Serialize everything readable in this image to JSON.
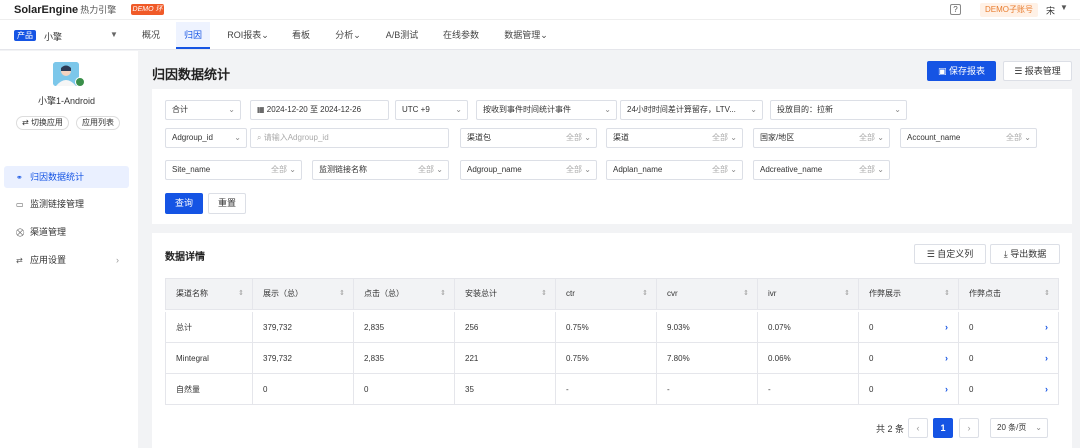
{
  "brand": {
    "logo": "SolarEngine",
    "subtitle": "热力引擎",
    "demo_tag": "DEMO 环境"
  },
  "header": {
    "help_icon": "?",
    "demo_account": "DEMO子账号",
    "user": "宋",
    "user_caret": "▼"
  },
  "nav": {
    "product_tag": "产品",
    "app_name": "小擎",
    "app_caret": "▼",
    "items": [
      "概况",
      "归因",
      "ROI报表⌄",
      "看板",
      "分析⌄",
      "A/B测试",
      "在线参数",
      "数据管理⌄"
    ],
    "active_index": 1
  },
  "sidebar": {
    "device": "小擎1-Android",
    "switch_app": "切换应用",
    "app_list": "应用列表",
    "items": [
      {
        "label": "归因数据统计",
        "icon": "attribution-icon",
        "glyph": "⚭"
      },
      {
        "label": "监测链接管理",
        "icon": "monitor-link-icon",
        "glyph": "▭"
      },
      {
        "label": "渠道管理",
        "icon": "channel-icon",
        "glyph": "⛒"
      },
      {
        "label": "应用设置",
        "icon": "settings-icon",
        "glyph": "⇄",
        "chevron": "›"
      }
    ],
    "active_index": 0
  },
  "page": {
    "title": "归因数据统计",
    "save_report": "保存报表",
    "manage_report": "报表管理"
  },
  "filters": {
    "row1": {
      "agg": "合计",
      "date_range": "2024-12-20 至 2024-12-26",
      "timezone": "UTC +9",
      "stat_method": "按收到事件时间统计事件",
      "retention": "24小时时间差计算留存，LTV...",
      "goal": "投放目的：拉新"
    },
    "adgroup_id_label": "Adgroup_id",
    "adgroup_id_placeholder": "请输入Adgroup_id",
    "dropdowns": [
      {
        "label": "渠道包",
        "value": "全部"
      },
      {
        "label": "渠道",
        "value": "全部"
      },
      {
        "label": "国家/地区",
        "value": "全部"
      },
      {
        "label": "Account_name",
        "value": "全部"
      },
      {
        "label": "Site_name",
        "value": "全部"
      },
      {
        "label": "监测链接名称",
        "value": "全部"
      },
      {
        "label": "Adgroup_name",
        "value": "全部"
      },
      {
        "label": "Adplan_name",
        "value": "全部"
      },
      {
        "label": "Adcreative_name",
        "value": "全部"
      }
    ],
    "query": "查询",
    "reset": "重置"
  },
  "detail": {
    "title": "数据详情",
    "custom_columns": "自定义列",
    "export": "导出数据",
    "columns": [
      "渠道名称",
      "展示（总）",
      "点击（总）",
      "安装总计",
      "ctr",
      "cvr",
      "ivr",
      "作弊展示",
      "作弊点击"
    ],
    "rows": [
      [
        "总计",
        "379,732",
        "2,835",
        "256",
        "0.75%",
        "9.03%",
        "0.07%",
        "0",
        "0"
      ],
      [
        "Mintegral",
        "379,732",
        "2,835",
        "221",
        "0.75%",
        "7.80%",
        "0.06%",
        "0",
        "0"
      ],
      [
        "自然量",
        "0",
        "0",
        "35",
        "-",
        "-",
        "-",
        "0",
        "0"
      ]
    ]
  },
  "pager": {
    "total": "共 2 条",
    "prev": "‹",
    "page": "1",
    "next": "›",
    "page_size": "20 条/页"
  }
}
